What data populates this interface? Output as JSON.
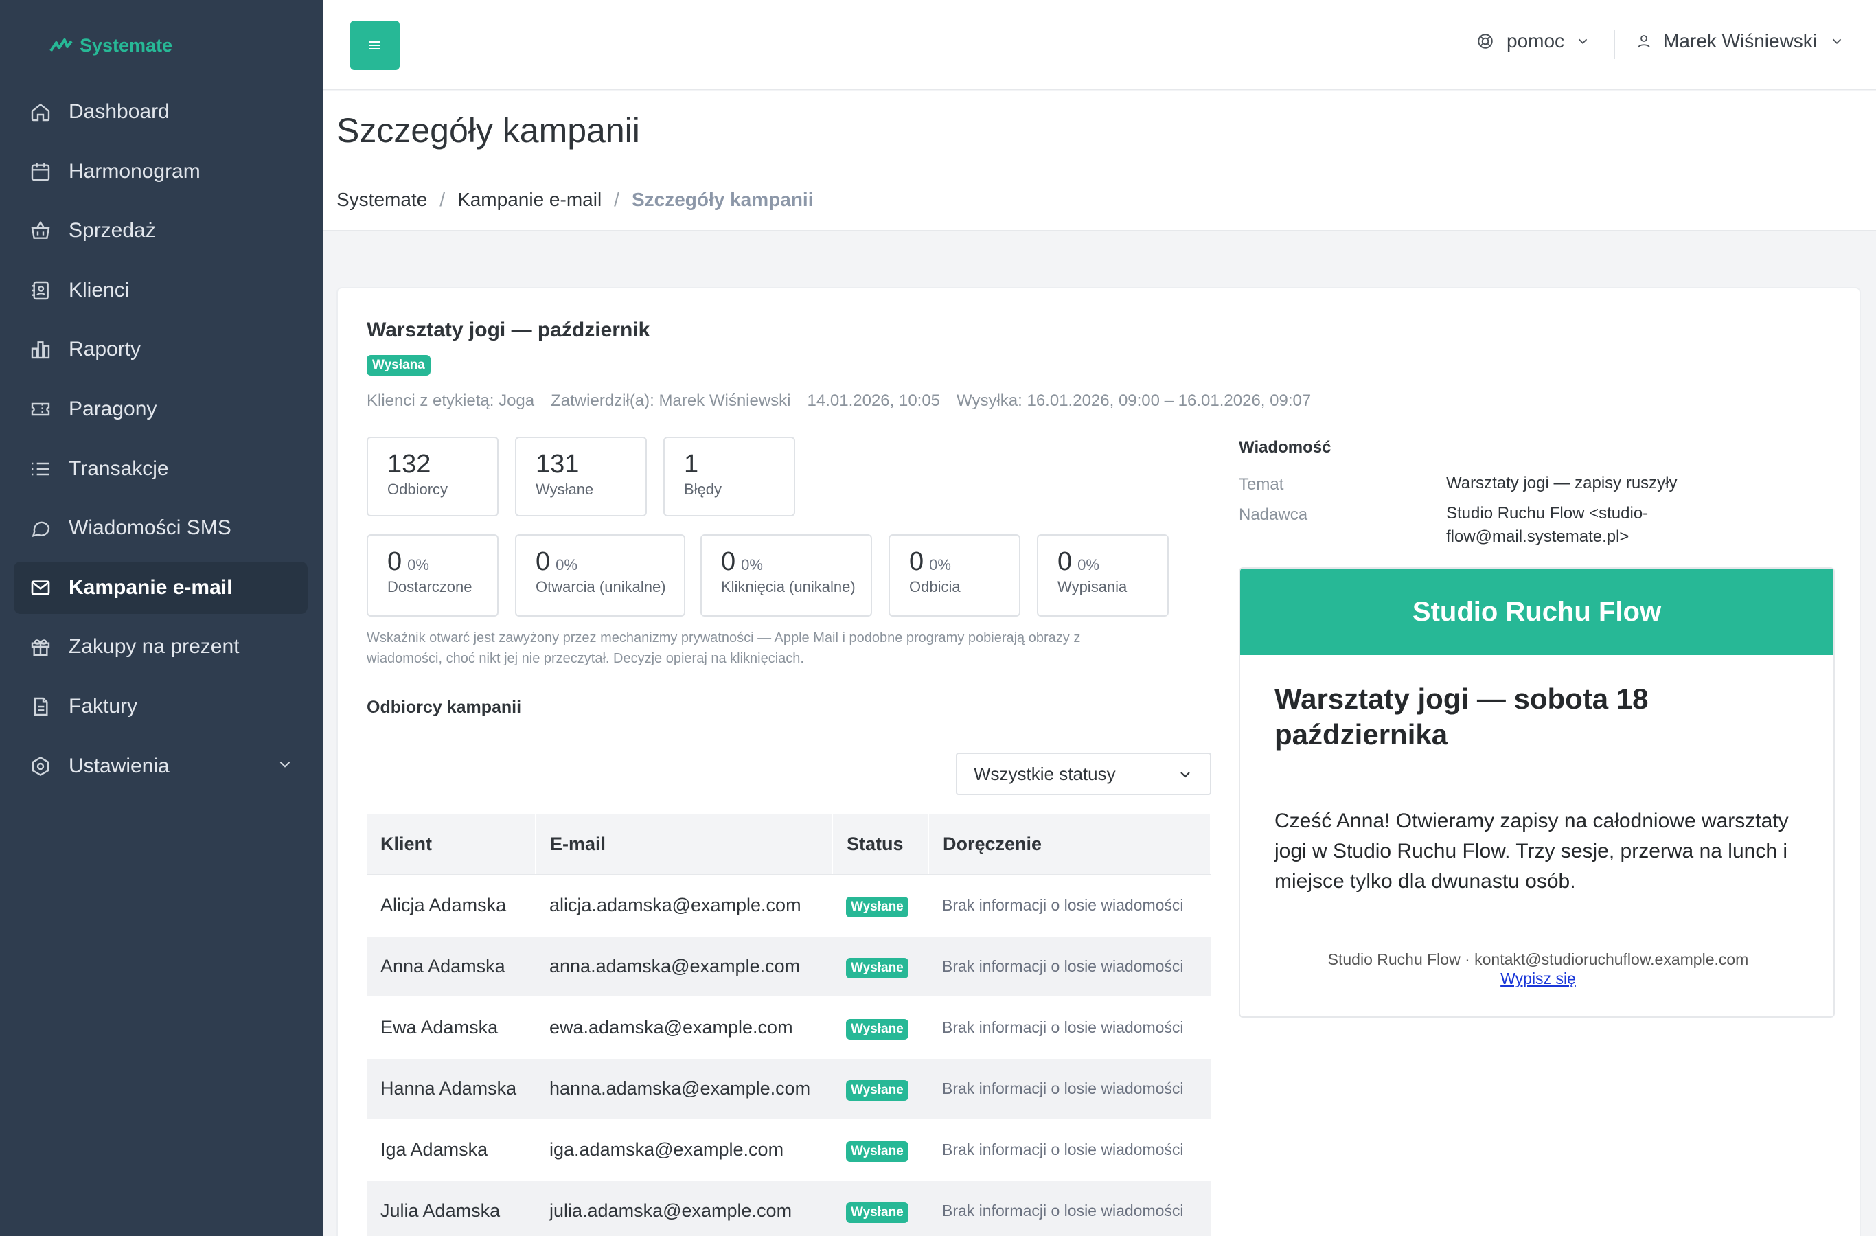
{
  "app": {
    "logo_text": "Systemate",
    "brand_color": "#27b896"
  },
  "sidebar": {
    "items": [
      {
        "label": "Dashboard",
        "icon": "home-icon"
      },
      {
        "label": "Harmonogram",
        "icon": "calendar-icon"
      },
      {
        "label": "Sprzedaż",
        "icon": "basket-icon"
      },
      {
        "label": "Klienci",
        "icon": "contacts-icon"
      },
      {
        "label": "Raporty",
        "icon": "bar-chart-icon"
      },
      {
        "label": "Paragony",
        "icon": "ticket-icon"
      },
      {
        "label": "Transakcje",
        "icon": "list-icon"
      },
      {
        "label": "Wiadomości SMS",
        "icon": "chat-icon"
      },
      {
        "label": "Kampanie e-mail",
        "icon": "mail-icon",
        "active": true
      },
      {
        "label": "Zakupy na prezent",
        "icon": "gift-icon"
      },
      {
        "label": "Faktury",
        "icon": "document-icon"
      },
      {
        "label": "Ustawienia",
        "icon": "settings-icon"
      }
    ]
  },
  "topbar": {
    "help_label": "pomoc",
    "user_name": "Marek Wiśniewski"
  },
  "page": {
    "title": "Szczegóły kampanii",
    "breadcrumb": [
      "Systemate",
      "Kampanie e-mail",
      "Szczegóły kampanii"
    ]
  },
  "campaign": {
    "title": "Warsztaty jogi — październik",
    "status": "Wysłana",
    "meta": {
      "audience": "Klienci z etykietą: Joga",
      "approved_by": "Zatwierdził(a): Marek Wiśniewski",
      "approved_at": "14.01.2026, 10:05",
      "sending": "Wysyłka: 16.01.2026, 09:00 – 16.01.2026, 09:07"
    },
    "stats_top": [
      {
        "value": "132",
        "label": "Odbiorcy"
      },
      {
        "value": "131",
        "label": "Wysłane"
      },
      {
        "value": "1",
        "label": "Błędy"
      }
    ],
    "stats_bottom": [
      {
        "value": "0",
        "pct": "0%",
        "label": "Dostarczone"
      },
      {
        "value": "0",
        "pct": "0%",
        "label": "Otwarcia (unikalne)"
      },
      {
        "value": "0",
        "pct": "0%",
        "label": "Kliknięcia (unikalne)"
      },
      {
        "value": "0",
        "pct": "0%",
        "label": "Odbicia"
      },
      {
        "value": "0",
        "pct": "0%",
        "label": "Wypisania"
      }
    ],
    "note": "Wskaźnik otwarć jest zawyżony przez mechanizmy prywatności — Apple Mail i podobne programy pobierają obrazy z wiadomości, choć nikt jej nie przeczytał. Decyzje opieraj na kliknięciach."
  },
  "recipients": {
    "section_title": "Odbiorcy kampanii",
    "filter_value": "Wszystkie statusy",
    "columns": [
      "Klient",
      "E-mail",
      "Status",
      "Doręczenie"
    ],
    "rows": [
      {
        "client": "Alicja Adamska",
        "email": "alicja.adamska@example.com",
        "status": "Wysłane",
        "delivery": "Brak informacji o losie wiadomości"
      },
      {
        "client": "Anna Adamska",
        "email": "anna.adamska@example.com",
        "status": "Wysłane",
        "delivery": "Brak informacji o losie wiadomości"
      },
      {
        "client": "Ewa Adamska",
        "email": "ewa.adamska@example.com",
        "status": "Wysłane",
        "delivery": "Brak informacji o losie wiadomości"
      },
      {
        "client": "Hanna Adamska",
        "email": "hanna.adamska@example.com",
        "status": "Wysłane",
        "delivery": "Brak informacji o losie wiadomości"
      },
      {
        "client": "Iga Adamska",
        "email": "iga.adamska@example.com",
        "status": "Wysłane",
        "delivery": "Brak informacji o losie wiadomości"
      },
      {
        "client": "Julia Adamska",
        "email": "julia.adamska@example.com",
        "status": "Wysłane",
        "delivery": "Brak informacji o losie wiadomości"
      }
    ]
  },
  "message": {
    "section_title": "Wiadomość",
    "subject_label": "Temat",
    "subject": "Warsztaty jogi — zapisy ruszyły",
    "sender_label": "Nadawca",
    "sender": "Studio Ruchu Flow <studio-flow@mail.systemate.pl>",
    "preview": {
      "header": "Studio Ruchu Flow",
      "title": "Warsztaty jogi — sobota 18 października",
      "body": "Cześć Anna! Otwieramy zapisy na całodniowe warsztaty jogi w Studio Ruchu Flow. Trzy sesje, przerwa na lunch i miejsce tylko dla dwunastu osób.",
      "footer": "Studio Ruchu Flow · kontakt@studioruchuflow.example.com",
      "unsubscribe": "Wypisz się"
    }
  }
}
